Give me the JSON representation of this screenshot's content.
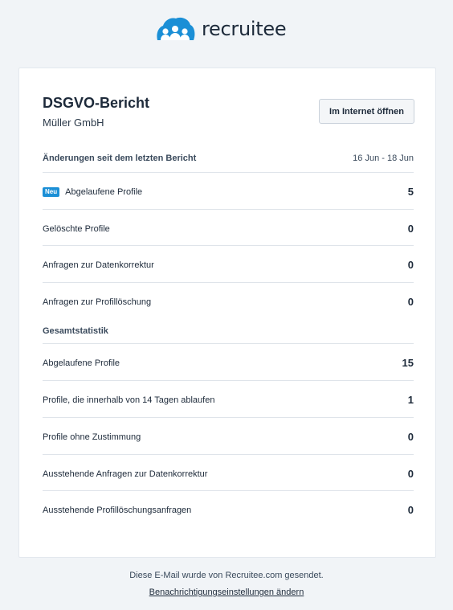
{
  "brand": {
    "name": "recruitee",
    "color": "#1b8fd6"
  },
  "report": {
    "title": "DSGVO-Bericht",
    "company": "Müller GmbH",
    "open_button": "Im Internet öffnen"
  },
  "changes": {
    "heading": "Änderungen seit dem letzten Bericht",
    "range": "16 Jun - 18 Jun",
    "rows": [
      {
        "badge": "Neu",
        "label": "Abgelaufene Profile",
        "value": "5"
      },
      {
        "label": "Gelöschte Profile",
        "value": "0"
      },
      {
        "label": "Anfragen zur Datenkorrektur",
        "value": "0"
      },
      {
        "label": "Anfragen zur Profillöschung",
        "value": "0"
      }
    ]
  },
  "totals": {
    "heading": "Gesamtstatistik",
    "rows": [
      {
        "label": "Abgelaufene Profile",
        "value": "15"
      },
      {
        "label": "Profile, die innerhalb von 14 Tagen ablaufen",
        "value": "1"
      },
      {
        "label": "Profile ohne Zustimmung",
        "value": "0"
      },
      {
        "label": "Ausstehende Anfragen zur Datenkorrektur",
        "value": "0"
      },
      {
        "label": "Ausstehende Profillöschungsanfragen",
        "value": "0"
      }
    ]
  },
  "footer": {
    "sent_by": "Diese E-Mail wurde von Recruitee.com gesendet.",
    "settings_link": "Benachrichtigungseinstellungen ändern"
  }
}
